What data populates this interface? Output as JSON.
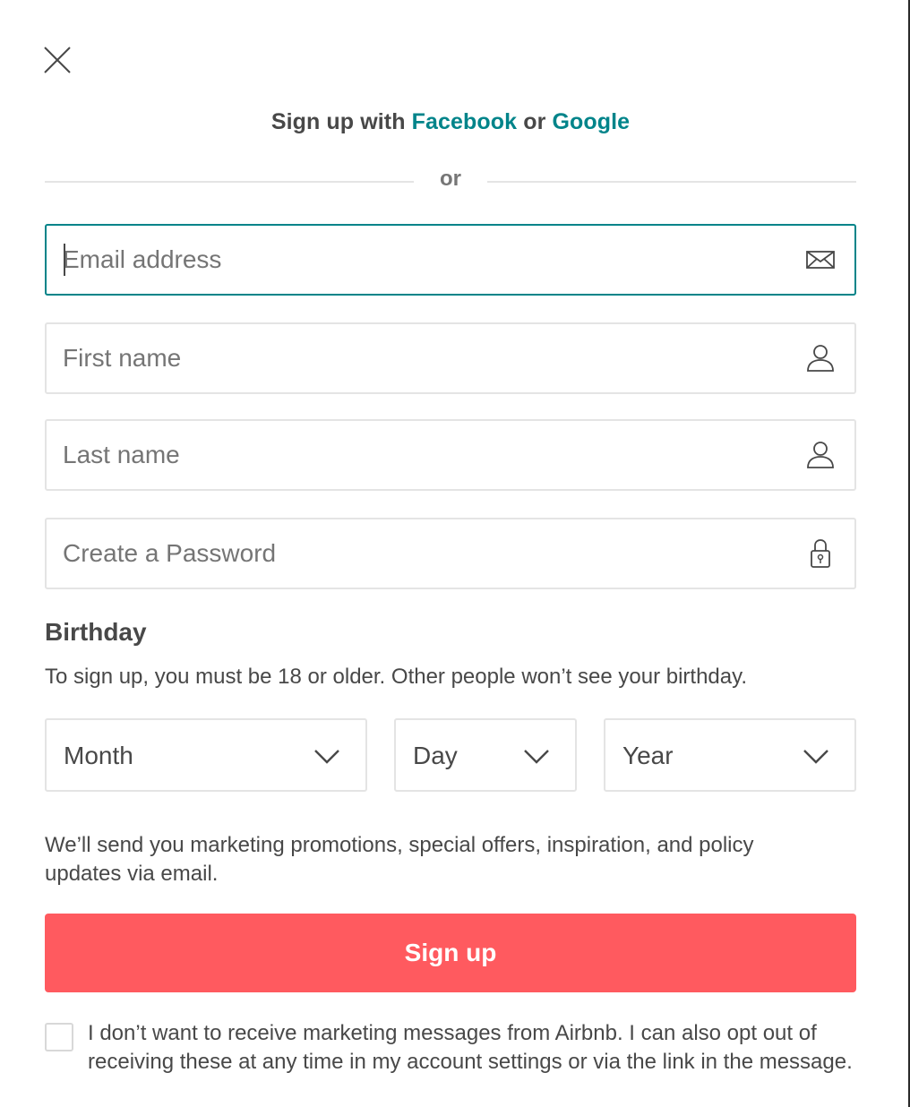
{
  "close": {
    "icon": "close-icon"
  },
  "social": {
    "prefix": "Sign up with",
    "facebook": "Facebook",
    "joiner": "or",
    "google": "Google"
  },
  "divider": {
    "text": "or"
  },
  "fields": {
    "email": {
      "placeholder": "Email address",
      "value": "",
      "icon": "envelope-icon"
    },
    "first_name": {
      "placeholder": "First name",
      "value": "",
      "icon": "user-icon"
    },
    "last_name": {
      "placeholder": "Last name",
      "value": "",
      "icon": "user-icon"
    },
    "password": {
      "placeholder": "Create a Password",
      "value": "",
      "icon": "lock-icon"
    }
  },
  "birthday": {
    "title": "Birthday",
    "note": "To sign up, you must be 18 or older. Other people won’t see your birthday.",
    "month": "Month",
    "day": "Day",
    "year": "Year"
  },
  "marketing_notice": "We’ll send you marketing promotions, special offers, inspiration, and policy updates via email.",
  "signup_button": "Sign up",
  "optout": {
    "checked": false,
    "text": "I don’t want to receive marketing messages from Airbnb. I can also opt out of receiving these at any time in my account settings or via the link in the message."
  },
  "colors": {
    "accent": "#00848a",
    "primary_button": "#ff5a5f",
    "text": "#484848",
    "border": "#e4e4e4",
    "focus_border": "#008489"
  }
}
